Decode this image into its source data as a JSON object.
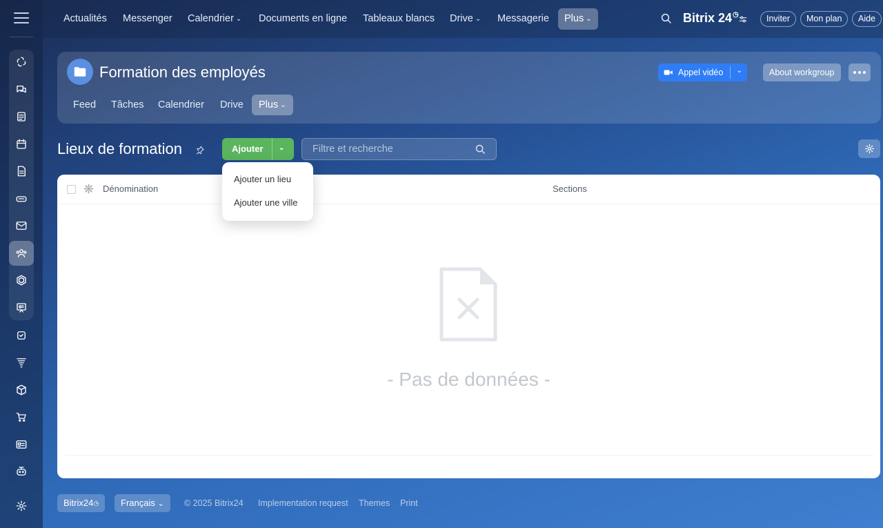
{
  "topnav": {
    "items": [
      {
        "label": "Actualités"
      },
      {
        "label": "Messenger"
      },
      {
        "label": "Calendrier"
      },
      {
        "label": "Documents en ligne"
      },
      {
        "label": "Tableaux blancs"
      },
      {
        "label": "Drive"
      },
      {
        "label": "Messagerie"
      },
      {
        "label": "Plus"
      }
    ],
    "brand": "Bitrix 24",
    "buttons": {
      "invite": "Inviter",
      "plan": "Mon plan",
      "help": "Aide"
    }
  },
  "sidebar": {
    "icons": [
      "chats-icon",
      "messenger-icon",
      "feed-icon",
      "calendar-icon",
      "document-icon",
      "drive-icon",
      "mail-icon",
      "workgroups-icon",
      "hexagon-icon",
      "boards-icon",
      "tasks-icon",
      "funnel-icon",
      "box-icon",
      "cart-icon",
      "id-card-icon",
      "robot-icon",
      "settings-icon"
    ],
    "active": "workgroups-icon"
  },
  "workgroup": {
    "title": "Formation des employés",
    "video_call": "Appel vidéo",
    "about": "About workgroup",
    "tabs": [
      {
        "label": "Feed"
      },
      {
        "label": "Tâches"
      },
      {
        "label": "Calendrier"
      },
      {
        "label": "Drive"
      },
      {
        "label": "Plus"
      }
    ]
  },
  "page": {
    "title": "Lieux de formation",
    "add_label": "Ajouter",
    "filter_placeholder": "Filtre et recherche"
  },
  "add_menu": {
    "items": [
      {
        "label": "Ajouter un lieu"
      },
      {
        "label": "Ajouter une ville"
      }
    ]
  },
  "grid": {
    "columns": [
      "Dénomination",
      "Sections"
    ],
    "empty_text": "- Pas de données -"
  },
  "footer": {
    "brand": "Bitrix24",
    "language": "Français",
    "copyright": "© 2025 Bitrix24",
    "links": [
      "Implementation request",
      "Themes",
      "Print"
    ]
  },
  "colors": {
    "add_button": "#5ab55e",
    "video_button": "#2f7df6"
  }
}
